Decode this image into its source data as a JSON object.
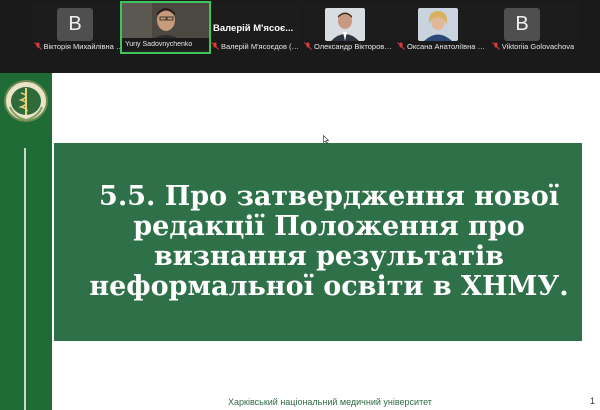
{
  "participants": [
    {
      "initial": "В",
      "name": "Вікторія Михайлівна З...",
      "has_photo": false
    },
    {
      "initial": "",
      "name": "Yuriy Sadovnychenko",
      "has_photo": true,
      "active": true
    },
    {
      "initial": "",
      "name": "Валерій М'ясоєдов (Х...",
      "has_photo": false,
      "header_name": "Валерій М'ясоє..."
    },
    {
      "initial": "",
      "name": "Олександр Вікторови...",
      "has_photo": true
    },
    {
      "initial": "",
      "name": "Оксана Анатоліївна Н...",
      "has_photo": true
    },
    {
      "initial": "В",
      "name": "Viktoriia Golovachova",
      "has_photo": false
    }
  ],
  "slide": {
    "title": "5.5. Про затвердження нової редакції Положення про визнання результатів неформальної освіти в ХНМУ.",
    "footer": "Харківський національний медичний університет",
    "page_number": "1"
  },
  "colors": {
    "sidebar": "#1f6b36",
    "title_box": "#2e7148",
    "active_border": "#3ec45a",
    "mic_muted": "#e0393e"
  }
}
